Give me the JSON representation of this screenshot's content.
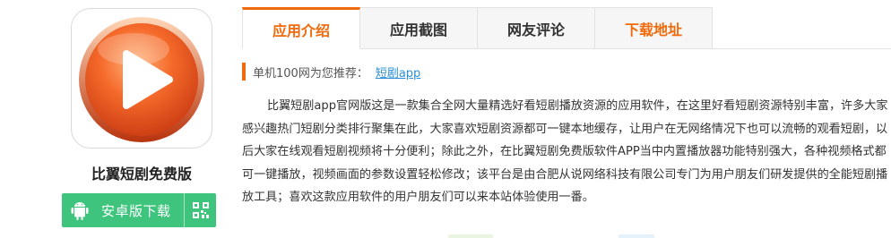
{
  "app": {
    "name": "比翼短剧免费版",
    "icon": "play-button-app-icon",
    "download": {
      "label": "安卓版下载",
      "platform_icon": "android-icon",
      "qr_icon": "qr-code-icon",
      "color": "#3ec47d"
    }
  },
  "tabs": [
    {
      "label": "应用介绍",
      "active": true
    },
    {
      "label": "应用截图",
      "active": false
    },
    {
      "label": "网友评论",
      "active": false
    },
    {
      "label": "下载地址",
      "active": false
    }
  ],
  "accent_color": "#f0690a",
  "recommend": {
    "prefix": "单机100网为您推荐：",
    "link": "短剧app"
  },
  "description": "比翼短剧app官网版这是一款集合全网大量精选好看短剧播放资源的应用软件，在这里好看短剧资源特别丰富，许多大家感兴趣热门短剧分类排行聚集在此，大家喜欢短剧资源都可一键本地缓存，让用户在无网络情况下也可以流畅的观看短剧，以后大家在线观看短剧视频将十分便利；除此之外，在比翼短剧免费版软件APP当中内置播放器功能特别强大，各种视频格式都可一键播放，视频画面的参数设置轻松修改；该平台是由合肥从说网络科技有限公司专门为用户朋友们研发提供的全能短剧播放工具；喜欢这款应用软件的用户朋友们可以来本站体验使用一番。"
}
